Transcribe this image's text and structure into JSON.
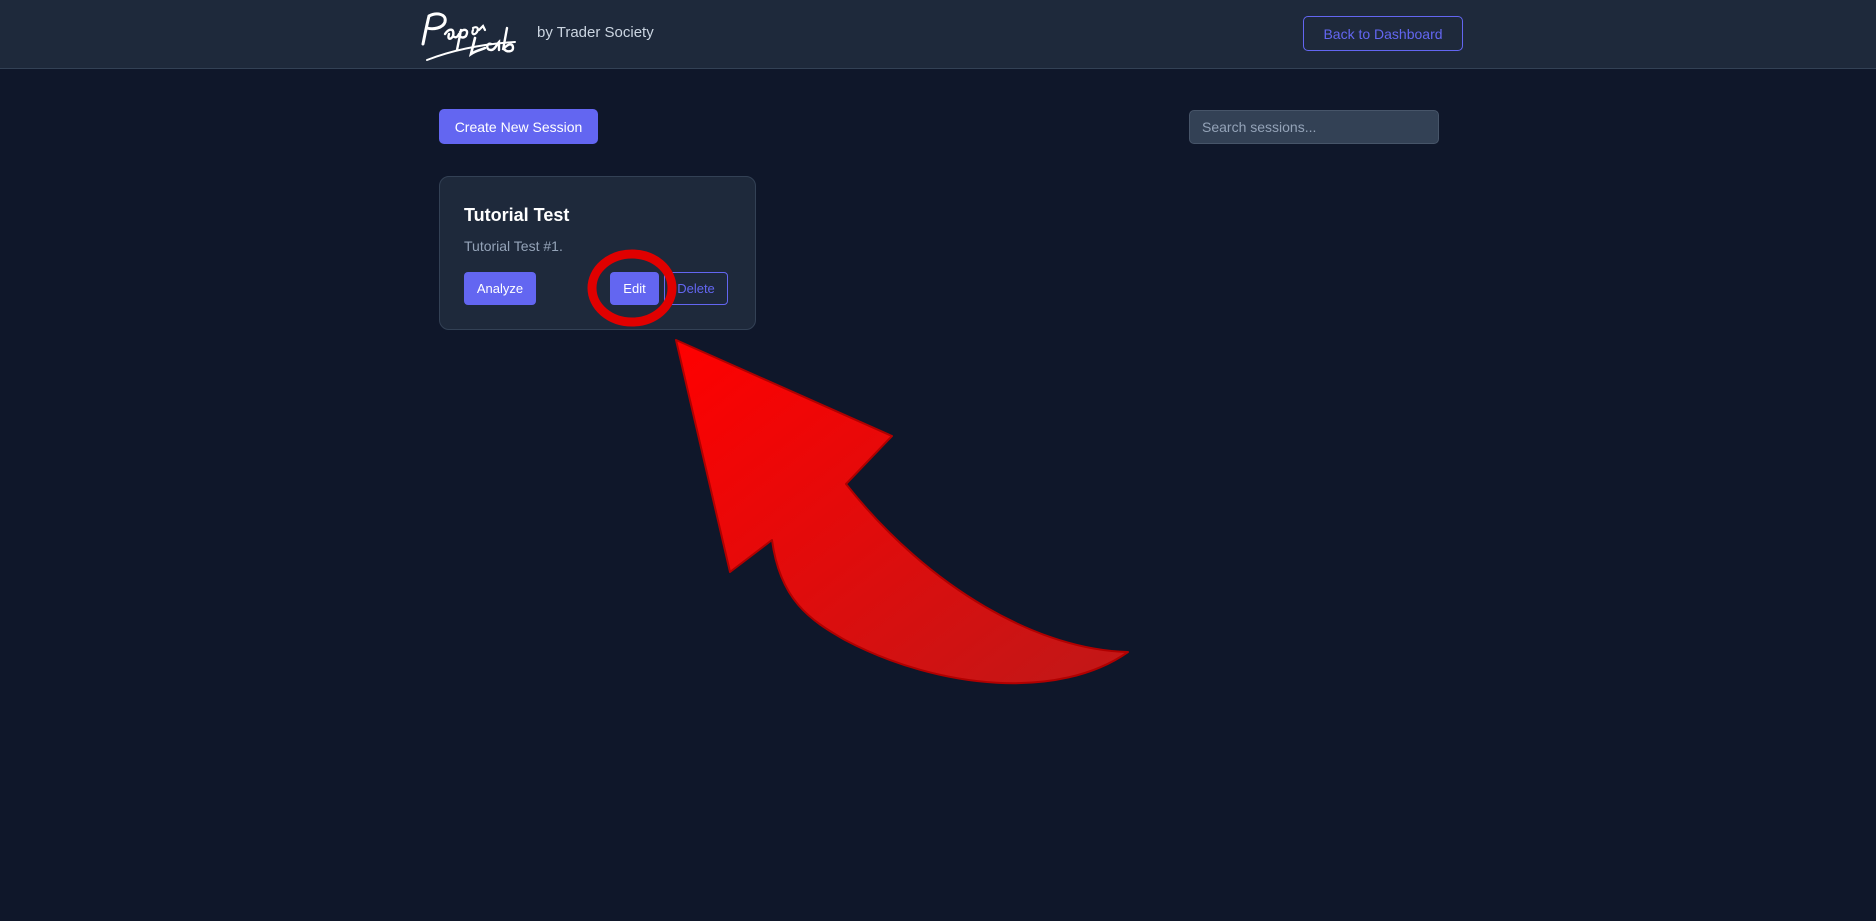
{
  "header": {
    "logo_text": "PaperLab",
    "brand_subtitle": "by Trader Society",
    "back_button": "Back to Dashboard"
  },
  "toolbar": {
    "create_button": "Create New Session",
    "search_placeholder": "Search sessions..."
  },
  "sessions": [
    {
      "title": "Tutorial Test",
      "description": "Tutorial Test #1.",
      "analyze_label": "Analyze",
      "edit_label": "Edit",
      "delete_label": "Delete"
    }
  ],
  "annotation": {
    "highlight_color": "#e00000",
    "arrow_color": "#ee0000"
  },
  "colors": {
    "accent": "#6366f1",
    "background": "#0f172a",
    "surface": "#1e293b"
  }
}
